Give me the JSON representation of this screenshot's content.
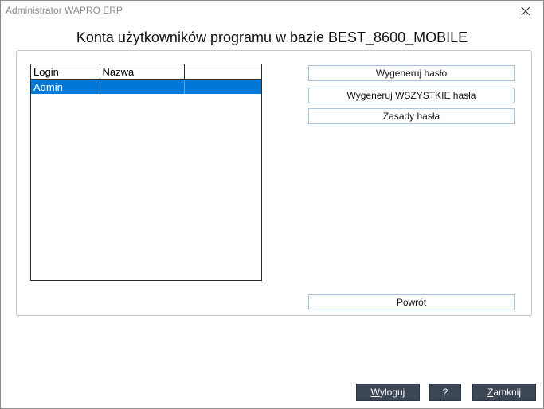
{
  "window": {
    "title": "Administrator WAPRO ERP",
    "close_icon": "close-icon"
  },
  "heading": "Konta użytkowników programu w bazie BEST_8600_MOBILE",
  "grid": {
    "columns": [
      "Login",
      "Nazwa",
      ""
    ],
    "rows": [
      {
        "login": "Admin",
        "nazwa": "",
        "extra": "",
        "selected": true
      }
    ]
  },
  "actions": {
    "generate_password": "Wygeneruj hasło",
    "generate_all_passwords": "Wygeneruj WSZYSTKIE hasła",
    "password_rules": "Zasady hasła",
    "back": "Powrót"
  },
  "footer": {
    "logout_prefix": "W",
    "logout_rest": "yloguj",
    "help": "?",
    "close_prefix": "Z",
    "close_rest": "amknij"
  },
  "colors": {
    "selection": "#0078d7",
    "dark_button": "#3c4654",
    "button_border": "#a9c4dd"
  }
}
